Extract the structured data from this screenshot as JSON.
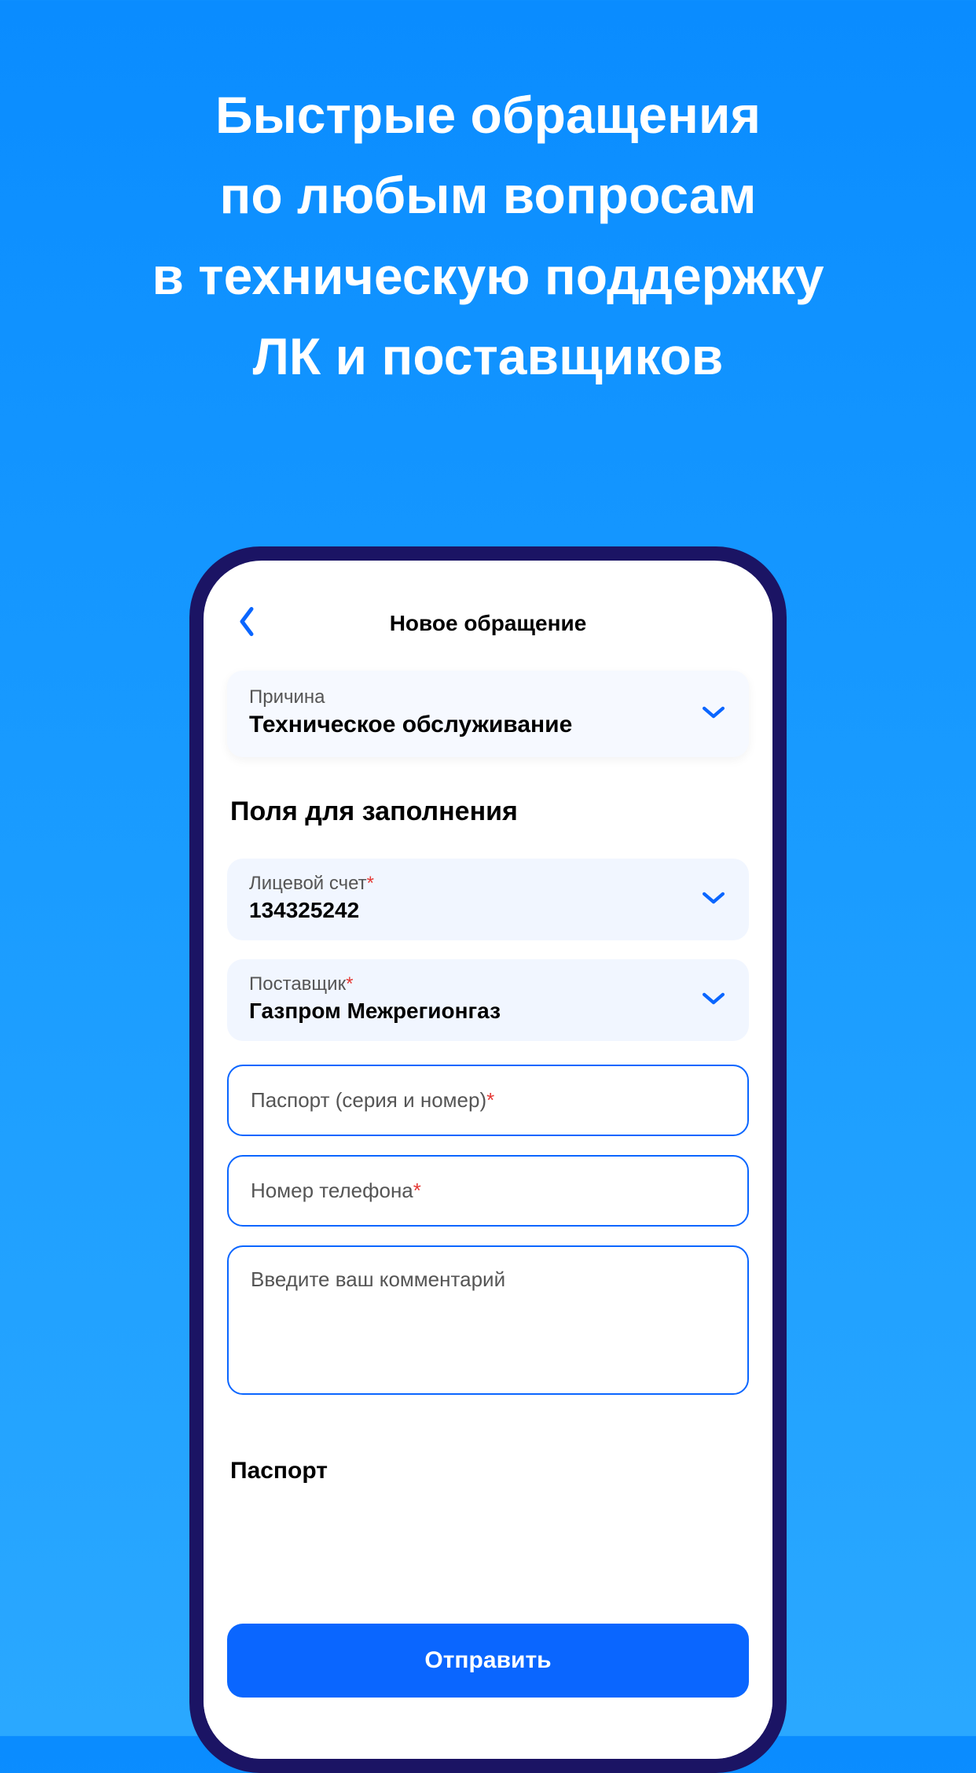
{
  "hero": {
    "line1": "Быстрые обращения",
    "line2": "по любым вопросам",
    "line3": "в техническую поддержку",
    "line4": "ЛК и поставщиков"
  },
  "screen": {
    "nav_title": "Новое обращение",
    "reason": {
      "label": "Причина",
      "value": "Техническое обслуживание"
    },
    "section_title": "Поля для заполнения",
    "account": {
      "label": "Лицевой счет",
      "value": "134325242"
    },
    "supplier": {
      "label": "Поставщик",
      "value": "Газпром Межрегионгаз"
    },
    "passport_placeholder": "Паспорт (серия и номер)",
    "phone_placeholder": "Номер телефона",
    "comment_placeholder": "Введите ваш комментарий",
    "partial_label": "Паспорт",
    "submit": "Отправить"
  }
}
